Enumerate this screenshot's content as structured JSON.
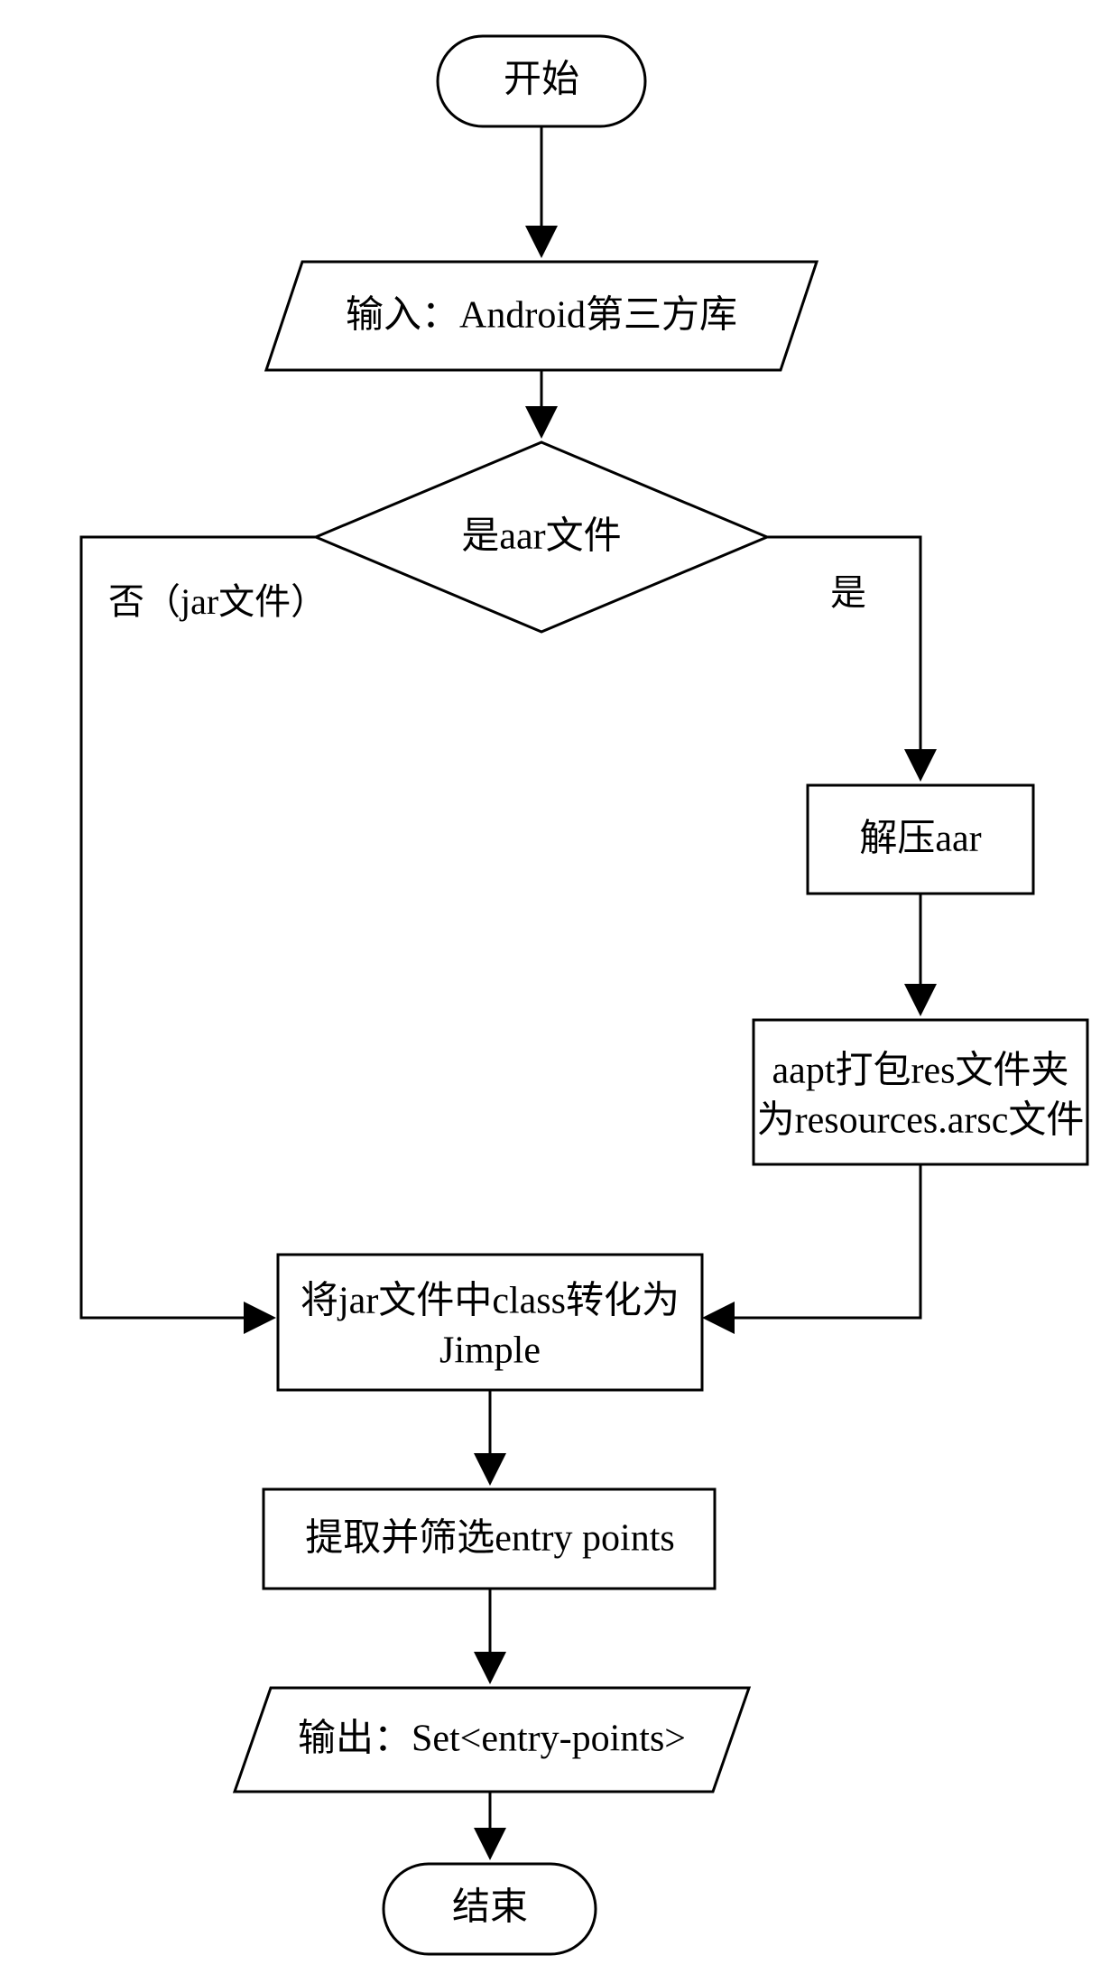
{
  "flowchart": {
    "start": "开始",
    "input": "输入：Android第三方库",
    "decision": "是aar文件",
    "decision_no": "否（jar文件）",
    "decision_yes": "是",
    "extract_aar": "解压aar",
    "aapt_pack_line1": "aapt打包res文件夹",
    "aapt_pack_line2": "为resources.arsc文件",
    "convert_jimple_line1": "将jar文件中class转化为",
    "convert_jimple_line2": "Jimple",
    "extract_entry": "提取并筛选entry points",
    "output": "输出：Set<entry-points>",
    "end": "结束"
  }
}
